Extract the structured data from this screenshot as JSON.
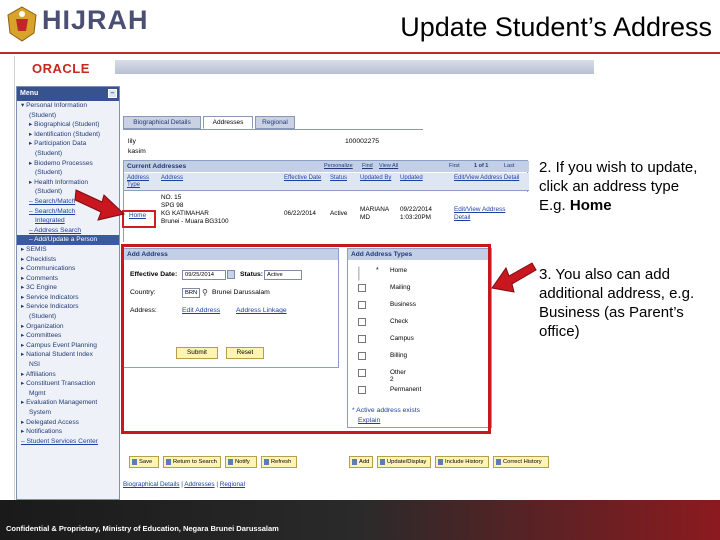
{
  "slide": {
    "logo": "HIJRAH",
    "title": "Update Student’s Address",
    "footer": "Confidential & Proprietary, Ministry of Education, Negara Brunei Darussalam"
  },
  "app": {
    "brand": "ORACLE"
  },
  "menu": {
    "title": "Menu",
    "items": [
      {
        "label": "Personal Information"
      },
      {
        "label": "(Student)"
      },
      {
        "label": "Biographical (Student)"
      },
      {
        "label": "Identification (Student)"
      },
      {
        "label": "Participation Data"
      },
      {
        "label": "(Student)"
      },
      {
        "label": "Biodemo Processes"
      },
      {
        "label": "(Student)"
      },
      {
        "label": "Health Information"
      },
      {
        "label": "(Student)"
      },
      {
        "label": "Search/Match"
      },
      {
        "label": "Search/Match"
      },
      {
        "label": "Integrated"
      },
      {
        "label": "Address Search"
      },
      {
        "label": "Add/Update a Person"
      },
      {
        "label": "SEMIS"
      },
      {
        "label": "Checklists"
      },
      {
        "label": "Communications"
      },
      {
        "label": "Comments"
      },
      {
        "label": "3C Engine"
      },
      {
        "label": "Service Indicators"
      },
      {
        "label": "Service Indicators"
      },
      {
        "label": "(Student)"
      },
      {
        "label": "Organization"
      },
      {
        "label": "Committees"
      },
      {
        "label": "Campus Event Planning"
      },
      {
        "label": "National Student Index"
      },
      {
        "label": "NSI"
      },
      {
        "label": "Affiliations"
      },
      {
        "label": "Constituent Transaction"
      },
      {
        "label": "Mgmt"
      },
      {
        "label": "Evaluation Management"
      },
      {
        "label": "System"
      },
      {
        "label": "Delegated Access"
      },
      {
        "label": "Notifications"
      },
      {
        "label": "Student Services Center"
      }
    ]
  },
  "tabs": [
    {
      "label": "Biographical Details"
    },
    {
      "label": "Addresses"
    },
    {
      "label": "Regional"
    }
  ],
  "person": {
    "name": "lily",
    "surname": "kasim",
    "id": "100002275"
  },
  "current_addresses": {
    "title": "Current Addresses",
    "nav_personalize": "Personalize",
    "nav_find": "Find",
    "nav_view_all": "View All",
    "nav_first": "First",
    "nav_range": "1 of 1",
    "nav_last": "Last",
    "headers": {
      "address_type": "Address Type",
      "address": "Address",
      "effective_date": "Effective Date",
      "status": "Status",
      "updated_by": "Updated By",
      "updated": "Updated",
      "edit_view": "Edit/View Address Detail"
    },
    "row": {
      "type": "Home",
      "address_line1": "NO. 15",
      "address_line2": "SPG 98",
      "address_line3": "KG KATIMAHAR",
      "address_line4": "Brunei - Muara BG3100",
      "effective_date": "06/22/2014",
      "status": "Active",
      "updated_by_1": "MARIANA",
      "updated_by_2": "MD",
      "updated_date": "09/22/2014",
      "updated_time": "1:03:20PM",
      "edit_view_1": "Edit/View Address",
      "edit_view_2": "Detail"
    }
  },
  "add_address": {
    "title": "Add Address",
    "effective_date_label": "Effective Date:",
    "effective_date_value": "09/25/2014",
    "status_label": "Status:",
    "status_value": "Active",
    "country_label": "Country:",
    "country_code": "BRN",
    "country_name": "Brunei Darussalam",
    "address_label": "Address:",
    "edit_address": "Edit Address",
    "address_linkage": "Address Linkage",
    "submit": "Submit",
    "reset": "Reset"
  },
  "address_types": {
    "title": "Add Address Types",
    "types": [
      {
        "label": "Home",
        "marker": "*"
      },
      {
        "label": "Mailing",
        "marker": ""
      },
      {
        "label": "Business",
        "marker": ""
      },
      {
        "label": "Check",
        "marker": ""
      },
      {
        "label": "Campus",
        "marker": ""
      },
      {
        "label": "Billing",
        "marker": ""
      },
      {
        "label": "Other 2",
        "marker": ""
      },
      {
        "label": "Permanent",
        "marker": ""
      }
    ],
    "note": "* Active address exists",
    "explain": "Explain"
  },
  "toolbar": {
    "save": "Save",
    "return_to_search": "Return to Search",
    "notify": "Notify",
    "refresh": "Refresh",
    "add": "Add",
    "update_display": "Update/Display",
    "include_history": "Include History",
    "correct_history": "Correct History"
  },
  "bottom_links": {
    "biographical": "Biographical Details",
    "addresses": "Addresses",
    "regional": "Regional"
  },
  "annotations": {
    "step2_text": "2. If you wish to update, click an address type E.g.",
    "step2_bold": "Home",
    "step3_text": "3. You also can add additional address, e.g. Business (as Parent’s office)"
  },
  "colors": {
    "highlight": "#c8171f",
    "oracle_red": "#c7271f",
    "peoplesoft_blue": "#36538f"
  }
}
